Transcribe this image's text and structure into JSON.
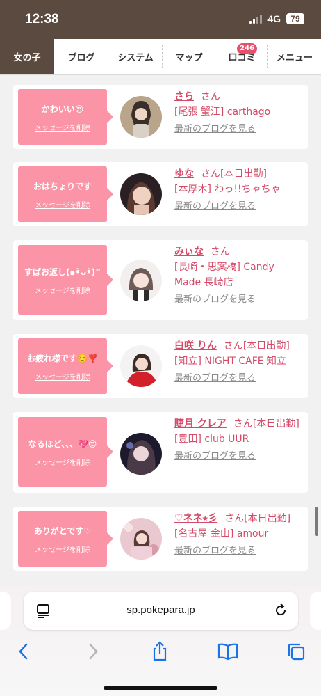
{
  "status": {
    "time": "12:38",
    "network": "4G",
    "battery": "79"
  },
  "nav": {
    "tabs": [
      {
        "label": "女の子",
        "active": true
      },
      {
        "label": "ブログ"
      },
      {
        "label": "システム"
      },
      {
        "label": "マップ"
      },
      {
        "label": "口コミ",
        "badge": "246"
      },
      {
        "label": "メニュー"
      }
    ]
  },
  "colors": {
    "brand_brown": "#5b4a3f",
    "bubble_pink": "#fa94a6",
    "link_pink": "#d44a67"
  },
  "messages": [
    {
      "text": "かわいい😍",
      "delete": "メッセージを削除",
      "name": "さら",
      "suffix": "さん",
      "shop": "[尾張 蟹江] carthago",
      "blog": "最新のブログを見る"
    },
    {
      "text": "おはちょりです",
      "delete": "メッセージを削除",
      "name": "ゆな",
      "suffix": "さん[本日出勤]",
      "shop": "[本厚木] わっ!!ちゃちゃ",
      "blog": "最新のブログを見る"
    },
    {
      "text": "すぱお返し(๑•̀ᴗ•̀)”",
      "delete": "メッセージを削除",
      "name": "みぃな",
      "suffix": "さん",
      "shop": "[長崎・思案橋] Candy Made 長崎店",
      "blog": "最新のブログを見る"
    },
    {
      "text": "お疲れ様です☺️❣️",
      "delete": "メッセージを削除",
      "name": "白咲 りん",
      "suffix": "さん[本日出勤]",
      "shop": "[知立] NIGHT CAFE 知立",
      "blog": "最新のブログを見る"
    },
    {
      "text": "なるほど、、、💖😍",
      "delete": "メッセージを削除",
      "name": "睫月 クレア",
      "suffix": "さん[本日出勤]",
      "shop": "[豊田] club UUR",
      "blog": "最新のブログを見る"
    },
    {
      "text": "ありがとです♡",
      "delete": "メッセージを削除",
      "name": "♡ネネ⭑彡",
      "suffix": "さん[本日出勤]",
      "shop": "[名古屋 金山] amour",
      "blog": "最新のブログを見る"
    }
  ],
  "browser": {
    "url": "sp.pokepara.jp"
  }
}
